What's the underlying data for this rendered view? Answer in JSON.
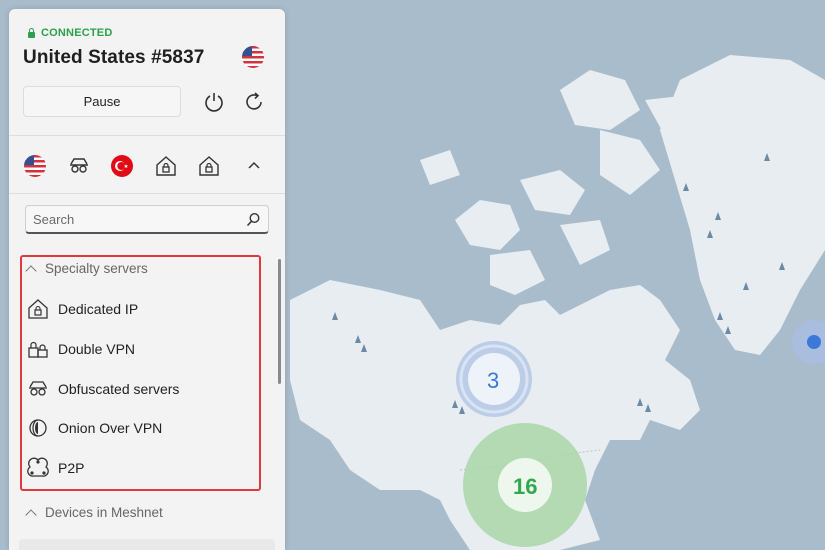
{
  "status": {
    "label": "CONNECTED",
    "color": "#2aa14a"
  },
  "server": {
    "name": "United States #5837",
    "flag": "us-flag-icon"
  },
  "controls": {
    "pause_label": "Pause",
    "power_icon": "power-icon",
    "refresh_icon": "refresh-icon"
  },
  "quick_connect": [
    "us-flag-icon",
    "obfuscated-icon",
    "turkey-flag-icon",
    "dedicated-ip-icon",
    "dedicated-ip-icon",
    "chevron-up-icon"
  ],
  "search": {
    "placeholder": "Search"
  },
  "specialty": {
    "header": "Specialty servers",
    "items": [
      {
        "label": "Dedicated IP",
        "icon": "house-lock-icon"
      },
      {
        "label": "Double VPN",
        "icon": "double-lock-icon"
      },
      {
        "label": "Obfuscated servers",
        "icon": "glasses-icon"
      },
      {
        "label": "Onion Over VPN",
        "icon": "onion-icon"
      },
      {
        "label": "P2P",
        "icon": "p2p-icon"
      }
    ]
  },
  "meshnet": {
    "header": "Devices in Meshnet"
  },
  "map": {
    "clusters": [
      {
        "count": "3",
        "color": "#3b78d8"
      },
      {
        "count": "16",
        "color": "#2fa84f"
      }
    ]
  },
  "colors": {
    "accent_red": "#e0383c",
    "map_water": "#a9bccb",
    "map_land": "#e7ecf0"
  }
}
